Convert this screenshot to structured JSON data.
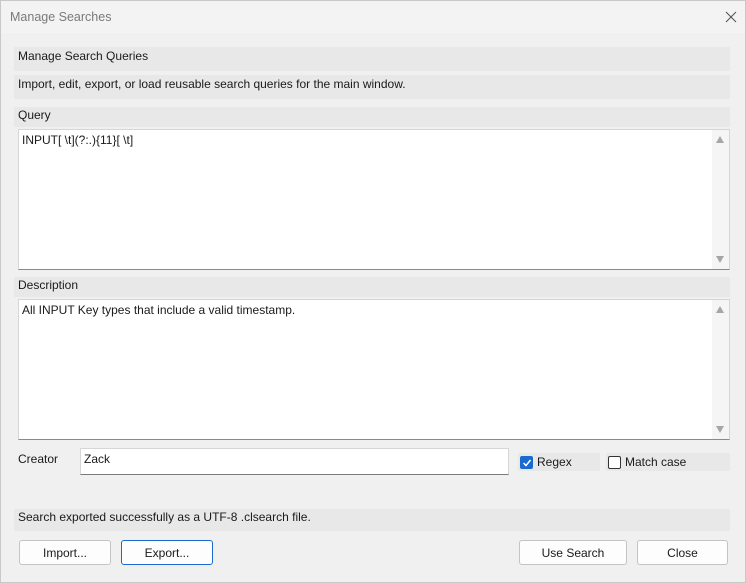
{
  "window": {
    "title": "Manage Searches"
  },
  "header": {
    "heading": "Manage Search Queries",
    "subtitle": "Import, edit, export, or load reusable search queries for the main window."
  },
  "query": {
    "label": "Query",
    "value": "INPUT[ \\t](?:.){11}[ \\t]"
  },
  "description": {
    "label": "Description",
    "value": "All INPUT Key types that include a valid timestamp."
  },
  "creator": {
    "label": "Creator",
    "value": "Zack"
  },
  "options": {
    "regex": {
      "label": "Regex",
      "checked": true
    },
    "match_case": {
      "label": "Match case",
      "checked": false
    }
  },
  "status": "Search exported successfully as a UTF-8 .clsearch file.",
  "buttons": {
    "import": "Import...",
    "export": "Export...",
    "use_search": "Use Search",
    "close": "Close"
  },
  "colors": {
    "accent": "#1a6bd0",
    "band": "#e8e8e8",
    "window_bg": "#f0f0f0"
  },
  "icons": {
    "close": "close-icon",
    "check": "checkmark-icon",
    "scroll_up": "scroll-up-arrow-icon",
    "scroll_down": "scroll-down-arrow-icon"
  }
}
